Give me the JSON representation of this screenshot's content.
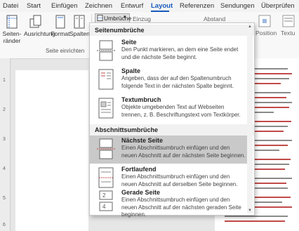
{
  "tabs": [
    "Datei",
    "Start",
    "Einfügen",
    "Zeichnen",
    "Entwurf",
    "Layout",
    "Referenzen",
    "Sendungen",
    "Überprüfen"
  ],
  "ribbon": {
    "seitenraender": "Seiten-\nränder",
    "ausrichtung": "Ausrichtung",
    "format": "Format",
    "spalten": "Spalten",
    "umbrueche": "Umbrüche",
    "group_label": "Seite einrichten",
    "einzug": "Einzug",
    "abstand": "Abstand",
    "position": "Position",
    "textumbruch_short": "Textu"
  },
  "menu": {
    "section1": "Seitenumbrüche",
    "section2": "Abschnittsumbrüche",
    "items": [
      {
        "title": "Seite",
        "desc": "Den Punkt markieren, an dem eine Seite endet und die nächste Seite beginnt.",
        "icon": "page-break-icon"
      },
      {
        "title": "Spalte",
        "desc": "Angeben, dass der auf den Spaltenumbruch folgende Text in der nächsten Spalte beginnt.",
        "icon": "column-break-icon"
      },
      {
        "title": "Textumbruch",
        "desc": "Objekte umgebenden Text auf Webseiten trennen, z. B. Beschriftungstext vom Textkörper.",
        "icon": "text-wrap-icon"
      },
      {
        "title": "Nächste Seite",
        "desc": "Einen Abschnittsumbruch einfügen und den neuen Abschnitt auf der nächsten Seite beginnen.",
        "icon": "next-page-icon"
      },
      {
        "title": "Fortlaufend",
        "desc": "Einen Abschnittsumbruch einfügen und den neuen Abschnitt auf derselben Seite beginnen.",
        "icon": "continuous-icon"
      },
      {
        "title": "Gerade Seite",
        "desc": "Einen Abschnittsumbruch einfügen und den neuen Abschnitt auf der nächsten geraden Seite beginnen.",
        "icon": "even-page-icon"
      }
    ]
  },
  "ruler_marks": [
    "1",
    "2",
    "3",
    "4",
    "5",
    "6"
  ],
  "colors": {
    "accent": "#185abd",
    "highlight": "#c9c9c9"
  }
}
